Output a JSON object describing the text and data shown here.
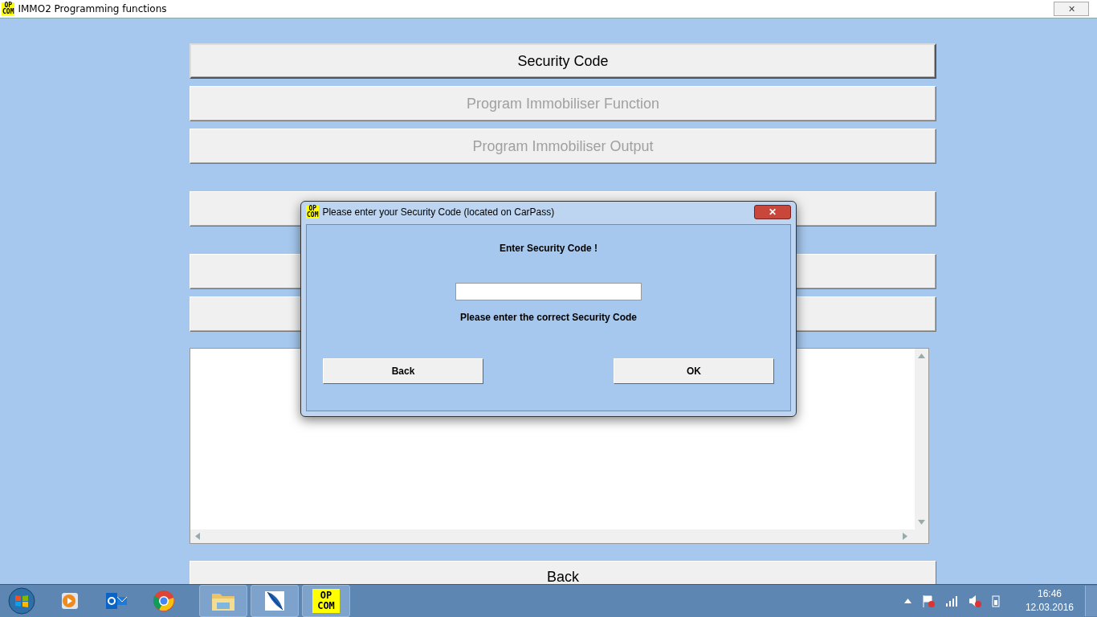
{
  "window": {
    "title": "IMMO2 Programming functions",
    "icon_text": [
      "OP",
      "COM"
    ],
    "close": "✕"
  },
  "buttons": [
    {
      "label": "Security Code",
      "disabled": false,
      "default": true
    },
    {
      "label": "Program Immobiliser Function",
      "disabled": true,
      "default": false
    },
    {
      "label": "Program Immobiliser Output",
      "disabled": true,
      "default": false
    },
    {
      "default": false,
      "gap_before": true
    },
    {
      "default": false,
      "gap_before": true
    },
    {
      "default": false,
      "gap_before": false
    }
  ],
  "log": {
    "kind": "textarea"
  },
  "back_button": {
    "label": "Back"
  },
  "dialog": {
    "title": "Please enter your Security Code (located on CarPass)",
    "icon_text": [
      "OP",
      "COM"
    ],
    "heading": "Enter Security Code !",
    "hint": "Please enter the correct Security Code",
    "buttons": [
      "Back",
      "OK"
    ]
  },
  "taskbar": {
    "open_apps": [
      {
        "kind": "folder"
      },
      {
        "kind": "feather"
      },
      {
        "kind": "opcom",
        "lines": [
          "OP",
          "COM"
        ]
      }
    ],
    "clock": {
      "time": "16:46",
      "date": "12.03.2016"
    }
  }
}
